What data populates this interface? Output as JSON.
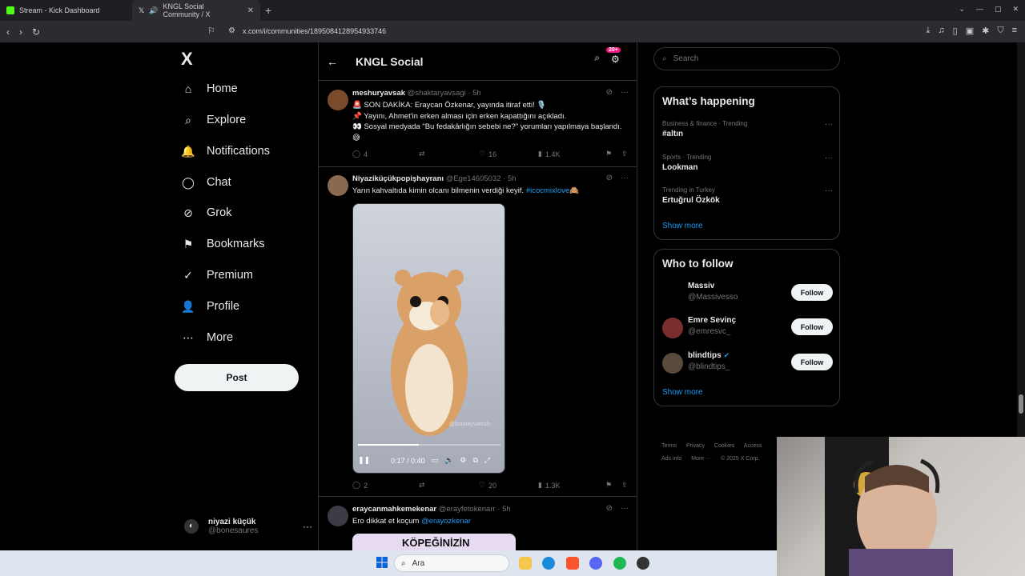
{
  "browser": {
    "tabs": [
      {
        "label": "Stream - Kick Dashboard"
      },
      {
        "label": "KNGL Social Community / X"
      }
    ],
    "url": "x.com/i/communities/1895084128954933746"
  },
  "nav": {
    "logo": "X",
    "items": [
      {
        "label": "Home",
        "icon": "⌂"
      },
      {
        "label": "Explore",
        "icon": "⌕"
      },
      {
        "label": "Notifications",
        "icon": "🔔"
      },
      {
        "label": "Chat",
        "icon": "◯"
      },
      {
        "label": "Grok",
        "icon": "⊘"
      },
      {
        "label": "Bookmarks",
        "icon": "⚑"
      },
      {
        "label": "Premium",
        "icon": "✓"
      },
      {
        "label": "Profile",
        "icon": "👤"
      },
      {
        "label": "More",
        "icon": "⋯"
      }
    ],
    "post_label": "Post",
    "account": {
      "name": "niyazi küçük",
      "handle": "@bonesaures"
    }
  },
  "feed": {
    "title": "KNGL Social",
    "badge": "20+",
    "tweets": [
      {
        "name": "meshuryavsak",
        "handle": "@shaktaryavsagi",
        "time": "· 5h",
        "lines": [
          "🚨 SON DAKİKA: Eraycan Özkenar, yayında itiraf etti! 🎙️",
          "📌 Yayını, Ahmet'in erken alması için erken kapattığını açıkladı.",
          "👀 Sosyal medyada \"Bu fedakârlığın sebebi ne?\" yorumları yapılmaya başlandı. 😅"
        ],
        "replies": "4",
        "likes": "16",
        "views": "1.4K"
      },
      {
        "name": "Niyaziküçükpopişhayranı",
        "handle": "@Ege14605032",
        "time": "· 5h",
        "text": "Yarın kahvaltıda kimin olcanı bilmenin verdiği keyif.",
        "hashtag": "#icocmixlove🙈",
        "video_time": "0:17 / 0:40",
        "video_progress": 0.425,
        "watermark": "@boundyvarnch",
        "replies": "2",
        "likes": "20",
        "views": "1.3K"
      },
      {
        "name": "eraycanmahkemekenar",
        "handle": "@erayfetokenarr",
        "time": "· 5h",
        "text": "Ero dikkat et koçum",
        "mention": "@erayozkenar",
        "image_text": "KÖPEĞİNİZİN"
      }
    ]
  },
  "right": {
    "search_placeholder": "Search",
    "happening_title": "What’s happening",
    "trends": [
      {
        "meta": "Business & finance · Trending",
        "title": "#altın"
      },
      {
        "meta": "Sports · Trending",
        "title": "Lookman"
      },
      {
        "meta": "Trending in Turkey",
        "title": "Ertuğrul Özkök"
      }
    ],
    "show_more": "Show more",
    "who_title": "Who to follow",
    "who": [
      {
        "name": "Massiv",
        "handle": "@Massivesso"
      },
      {
        "name": "Emre Sevinç",
        "handle": "@emresvc_"
      },
      {
        "name": "blindtips",
        "handle": "@blindtips_",
        "verified": true
      }
    ],
    "follow_label": "Follow",
    "footer": [
      "Terms",
      "Privacy",
      "Cookies",
      "Access",
      "Ads info",
      "More ···",
      "© 2025 X Corp."
    ]
  },
  "taskbar": {
    "search": "Ara"
  },
  "colors": {
    "accent": "#1d9bf0",
    "pink": "#f91880",
    "bg": "#000000",
    "border": "#2f3336",
    "muted": "#71767b"
  }
}
